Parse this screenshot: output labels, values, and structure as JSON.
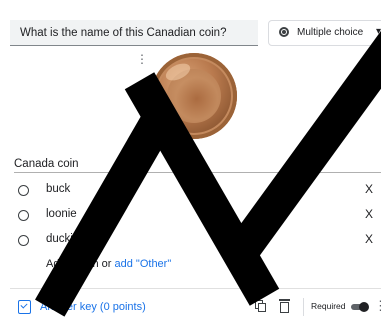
{
  "question": {
    "text": "What is the name of this Canadian coin?"
  },
  "type_select": {
    "label": "Multiple choice",
    "caret": "▾"
  },
  "image": {
    "caption": "Canada coin",
    "menu_glyph": "⋮",
    "corner_glyph": "⚲"
  },
  "options": [
    {
      "label": "buck",
      "remove": "X"
    },
    {
      "label": "loonie",
      "remove": "X"
    },
    {
      "label": "duckie",
      "remove": "X"
    }
  ],
  "add_option": {
    "text": "Add option",
    "or": " or ",
    "other_link": "add \"Other\""
  },
  "footer": {
    "answer_key": "Answer key (0 points)",
    "required_label": "Required",
    "more_glyph": "⋮",
    "required_on": true
  },
  "colors": {
    "accent": "#1a73e8",
    "text": "#202124",
    "obstruction": "#000000"
  },
  "icons": [
    "radio-icon",
    "image-menu-icon",
    "answer-key-icon",
    "duplicate-icon",
    "trash-icon",
    "more-vert-icon"
  ]
}
